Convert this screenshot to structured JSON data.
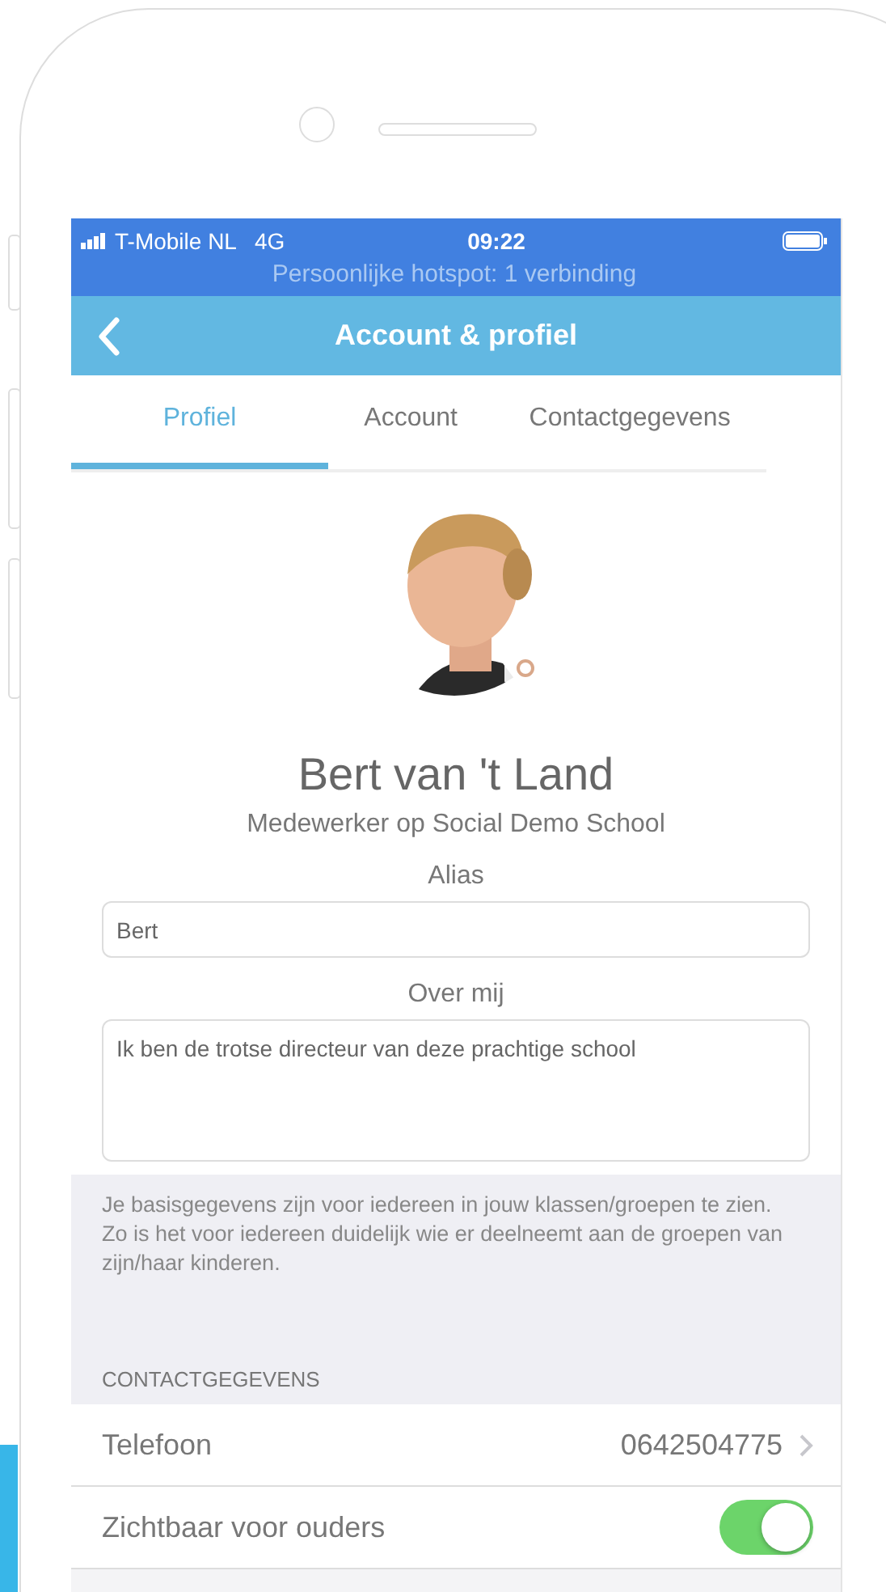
{
  "status_bar": {
    "carrier": "T-Mobile NL",
    "network": "4G",
    "time": "09:22",
    "hotspot": "Persoonlijke hotspot: 1 verbinding"
  },
  "nav_bar": {
    "title": "Account & profiel"
  },
  "tabs": [
    {
      "label": "Profiel",
      "selected": true
    },
    {
      "label": "Account",
      "selected": false
    },
    {
      "label": "Contactgegevens",
      "selected": false
    }
  ],
  "profile": {
    "name": "Bert van 't Land",
    "role": "Medewerker op Social Demo School"
  },
  "fields": [
    {
      "label": "Alias",
      "value": "Bert",
      "kind": "line"
    },
    {
      "label": "Over mij",
      "value": "Ik ben de trotse directeur van deze prachtige school",
      "kind": "area"
    }
  ],
  "info_text": "Je basisgegevens zijn voor iedereen in jouw klassen/groepen te zien. Zo is het voor iedereen duidelijk wie er deelneemt aan de groepen van zijn/haar kinderen.",
  "section_header": "CONTACTGEGEVENS",
  "rows": [
    {
      "kind": "link",
      "label": "Telefoon",
      "value": "0642504775"
    },
    {
      "kind": "toggle",
      "label": "Zichtbaar voor ouders",
      "on": true
    }
  ]
}
